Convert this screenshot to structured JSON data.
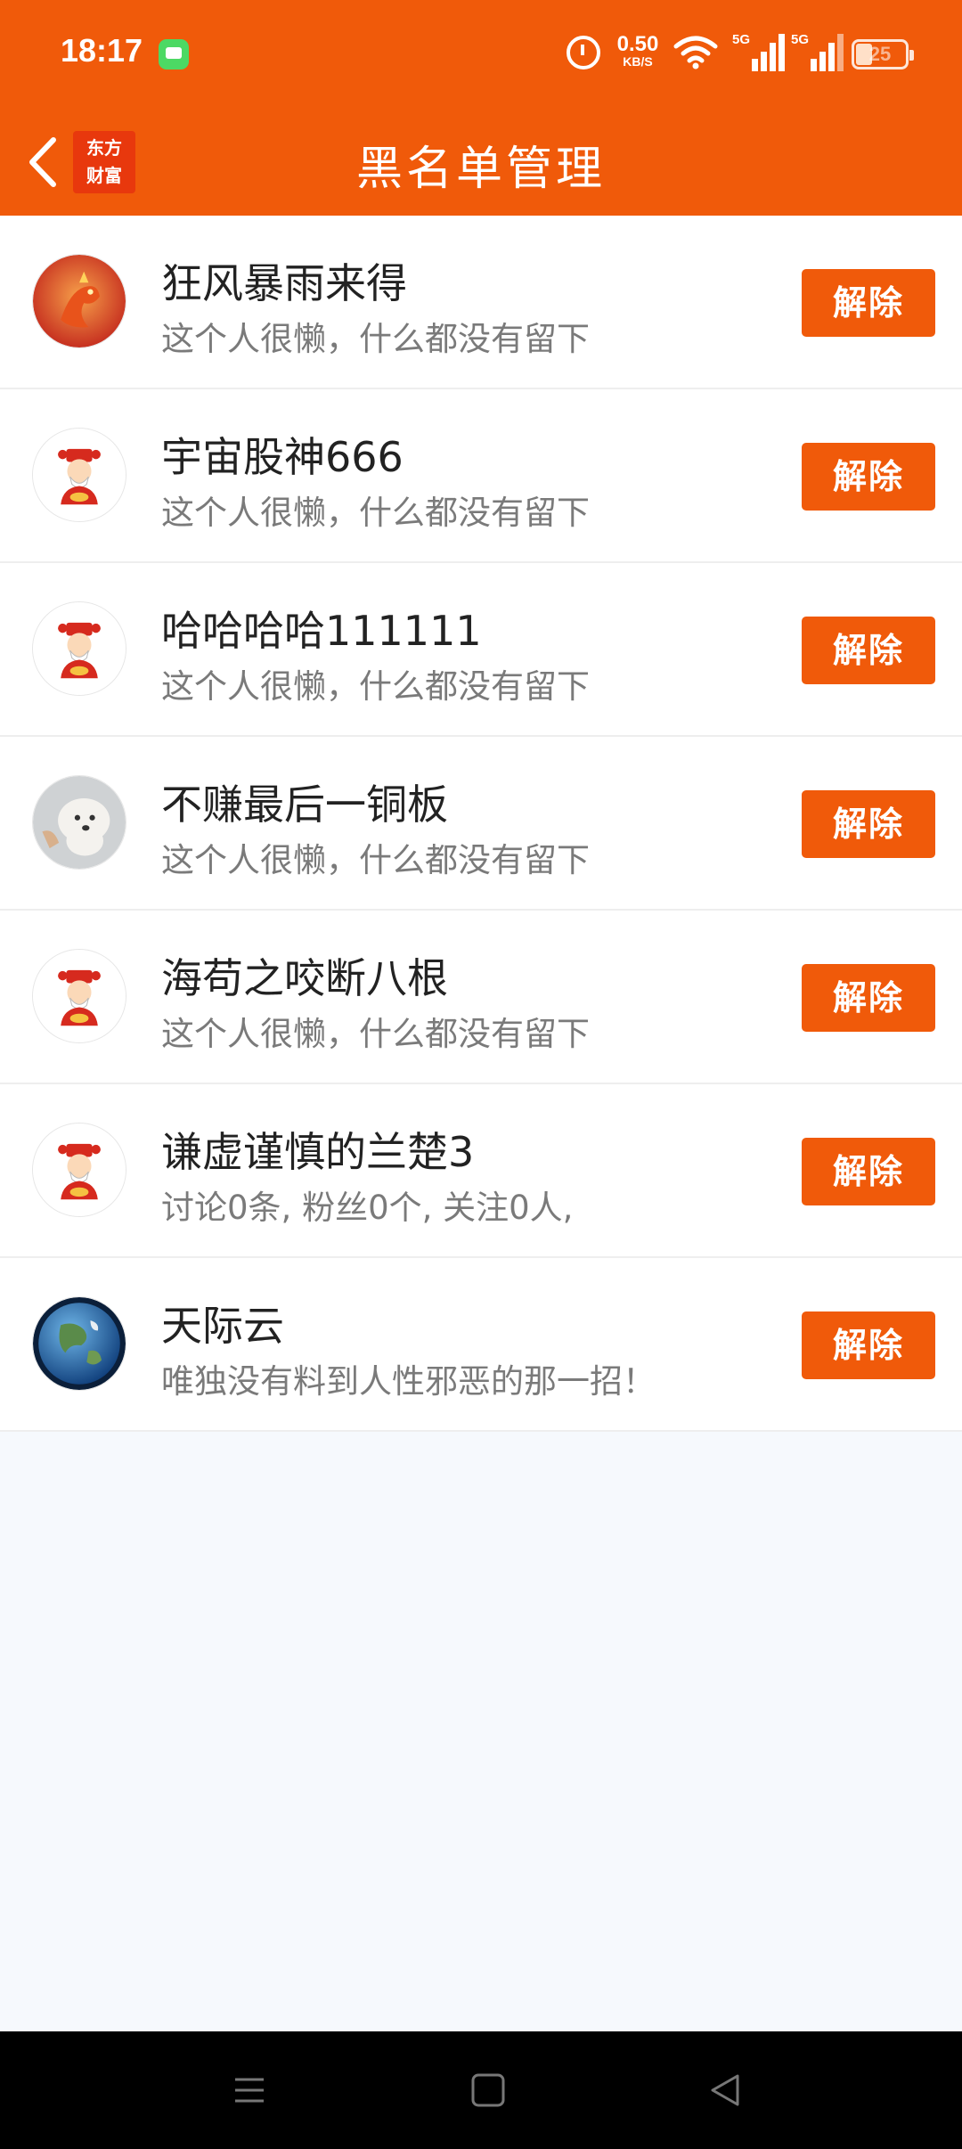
{
  "status_bar": {
    "time": "18:17",
    "net_speed_value": "0.50",
    "net_speed_unit": "KB/S",
    "signal1_label": "5G",
    "signal2_label": "5G",
    "battery": "25"
  },
  "header": {
    "logo_line1": "东方",
    "logo_line2": "财富",
    "title": "黑名单管理"
  },
  "colors": {
    "accent": "#f05a0a",
    "background": "#f6f9fd"
  },
  "blacklist": [
    {
      "name": "狂风暴雨来得",
      "desc": "这个人很懒，什么都没有留下",
      "avatar": "dragon-avatar",
      "button": "解除"
    },
    {
      "name": "宇宙股神666",
      "desc": "这个人很懒，什么都没有留下",
      "avatar": "fortune-god-avatar",
      "button": "解除"
    },
    {
      "name": "哈哈哈哈111111",
      "desc": "这个人很懒，什么都没有留下",
      "avatar": "fortune-god-avatar",
      "button": "解除"
    },
    {
      "name": "不赚最后一铜板",
      "desc": "这个人很懒，什么都没有留下",
      "avatar": "dog-avatar",
      "button": "解除"
    },
    {
      "name": "海苟之咬断八根",
      "desc": "这个人很懒，什么都没有留下",
      "avatar": "fortune-god-avatar",
      "button": "解除"
    },
    {
      "name": "谦虚谨慎的兰楚3",
      "desc": "讨论0条, 粉丝0个, 关注0人,",
      "avatar": "fortune-god-avatar",
      "button": "解除"
    },
    {
      "name": "天际云",
      "desc": "唯独没有料到人性邪恶的那一招！",
      "avatar": "earth-avatar",
      "button": "解除"
    }
  ],
  "system_nav": {
    "icons": [
      "menu-icon",
      "home-icon",
      "back-icon"
    ]
  }
}
